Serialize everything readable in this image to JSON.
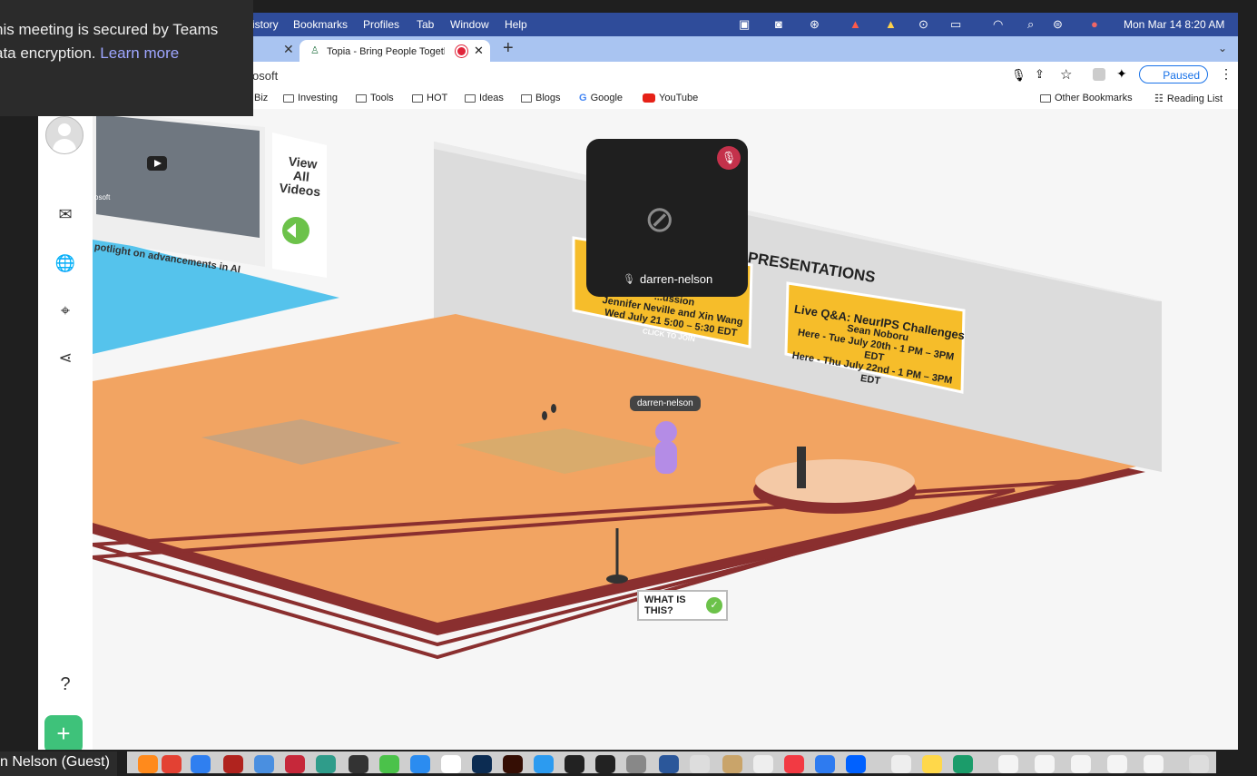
{
  "teams": {
    "notice_line1": "his meeting is secured by Teams",
    "notice_line2": "ata encryption.",
    "learn_more": "Learn more",
    "participant_label": "n Nelson (Guest)"
  },
  "menubar": {
    "items": [
      "istory",
      "Bookmarks",
      "Profiles",
      "Tab",
      "Window",
      "Help"
    ],
    "datetime": "Mon Mar 14  8:20 AM"
  },
  "browser": {
    "tab_title": "Topia - Bring People Togeth",
    "url_fragment": "osoft",
    "profile_label": "Paused",
    "bookmarks": [
      "Biz",
      "Investing",
      "Tools",
      "HOT",
      "Ideas",
      "Blogs",
      "Google",
      "YouTube"
    ],
    "other_bookmarks": "Other Bookmarks",
    "reading_list": "Reading List"
  },
  "world": {
    "video_panel_text": "potlight on advancements in AI",
    "video_panel_tag": "osoft",
    "view_all": "View All Videos",
    "presentations_title": "PRESENTATIONS",
    "sign1_line1": "...ussion",
    "sign1_line2": "Jennifer Neville and Xin Wang",
    "sign1_line3": "Wed July 21 5:00 – 5:30 EDT",
    "sign1_cta": "CLICK TO JOIN",
    "sign2_line1": "Live Q&A: NeurIPS Challenges",
    "sign2_line2": "Sean Noboru",
    "sign2_line3": "Here - Tue July 20th - 1 PM – 3PM EDT",
    "sign2_line4": "Here - Thu July 22nd - 1 PM – 3PM EDT",
    "avatar_name": "darren-nelson",
    "what_is_this": "WHAT IS THIS?"
  },
  "videocard": {
    "name": "darren-nelson"
  },
  "sidebar": {
    "help": "?",
    "add": "+"
  },
  "colors": {
    "floor": "#f2a462",
    "stage_edge": "#8a2f2f",
    "sign_yellow": "#f6bd2a",
    "teams_bg": "#2b2b2b",
    "menubar": "#2f4c9a",
    "accent_green": "#3ec27a"
  }
}
